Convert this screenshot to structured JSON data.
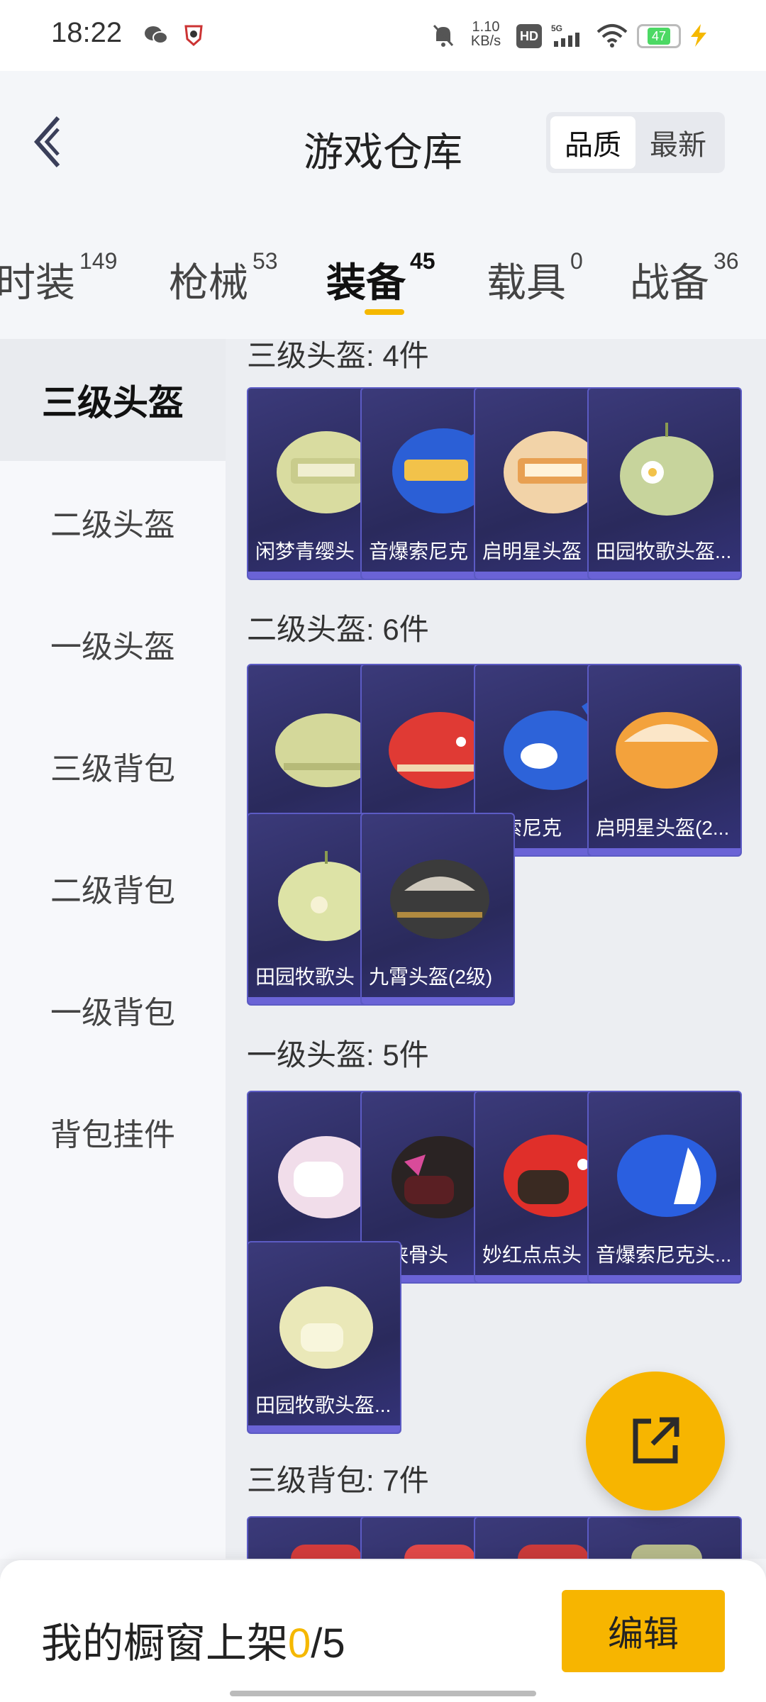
{
  "status_bar": {
    "time": "18:22",
    "net_speed": "1.10\nKB/s",
    "hd": "HD",
    "network": "5G",
    "battery": "47"
  },
  "header": {
    "title": "游戏仓库",
    "sort_options": [
      "品质",
      "最新"
    ]
  },
  "tabs": [
    {
      "label": "时装",
      "count": "149"
    },
    {
      "label": "枪械",
      "count": "53"
    },
    {
      "label": "装备",
      "count": "45"
    },
    {
      "label": "载具",
      "count": "0"
    },
    {
      "label": "战备",
      "count": "36"
    }
  ],
  "sidebar": [
    {
      "label": "三级头盔"
    },
    {
      "label": "二级头盔"
    },
    {
      "label": "一级头盔"
    },
    {
      "label": "三级背包"
    },
    {
      "label": "二级背包"
    },
    {
      "label": "一级背包"
    },
    {
      "label": "背包挂件"
    }
  ],
  "sections": [
    {
      "label": "三级头盔: 4件",
      "items": [
        "闲梦青缨头",
        "音爆索尼克",
        "启明星头盔",
        "田园牧歌头盔..."
      ]
    },
    {
      "label": "二级头盔: 6件",
      "items": [
        "",
        "",
        "爆索尼克",
        "启明星头盔(2...",
        "田园牧歌头",
        "九霄头盔(2级)"
      ]
    },
    {
      "label": "一级头盔: 5件",
      "items": [
        "",
        "鸦侠骨头",
        "妙红点点头",
        "音爆索尼克头...",
        "田园牧歌头盔..."
      ]
    },
    {
      "label": "三级背包: 7件",
      "items": [
        "",
        "",
        "",
        ""
      ]
    }
  ],
  "bottom": {
    "shelf_label": "我的橱窗上架",
    "current": "0",
    "total": "/5",
    "edit_label": "编辑"
  },
  "colors": {
    "accent": "#f5b800",
    "card_bg": "#2e2d66",
    "card_border": "#5c5bc4"
  }
}
